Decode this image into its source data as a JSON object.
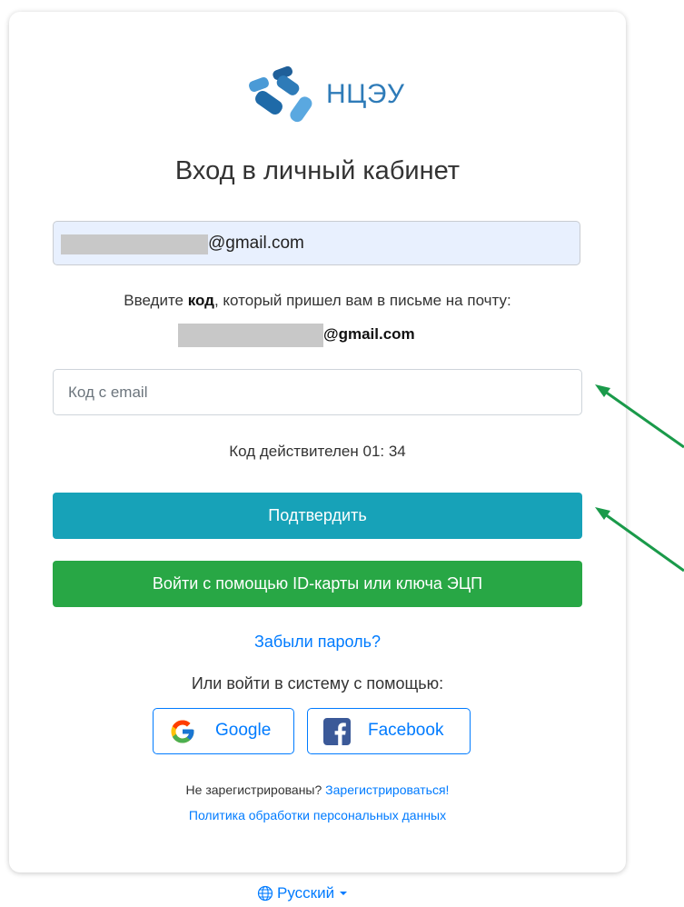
{
  "brand": {
    "logo_text": "НЦЭУ",
    "primary_color": "#2e7bb8"
  },
  "header": {
    "title": "Вход в личный кабинет"
  },
  "login_field": {
    "value_suffix": "@gmail.com"
  },
  "instruction": {
    "prefix": "Введите ",
    "bold": "код",
    "suffix": ", который пришел вам в письме на почту:",
    "email_suffix": "@gmail.com"
  },
  "code_input": {
    "placeholder": "Код с email",
    "value": ""
  },
  "timer": {
    "text": "Код действителен 01: 34"
  },
  "buttons": {
    "confirm": "Подтвердить",
    "ecp": "Войти с помощью ID-карты или ключа ЭЦП",
    "confirm_color": "#17a2b8",
    "ecp_color": "#28a745"
  },
  "forgot_password": "Забыли пароль?",
  "social": {
    "title": "Или войти в систему с помощью:",
    "google": "Google",
    "facebook": "Facebook"
  },
  "register": {
    "prompt": "Не зарегистрированы? ",
    "link": "Зарегистрироваться!"
  },
  "policy_link": "Политика обработки персональных данных",
  "language": {
    "label": "Русский",
    "icon": "globe-icon"
  },
  "annotations": {
    "arrow_color": "#1a9a4a"
  }
}
